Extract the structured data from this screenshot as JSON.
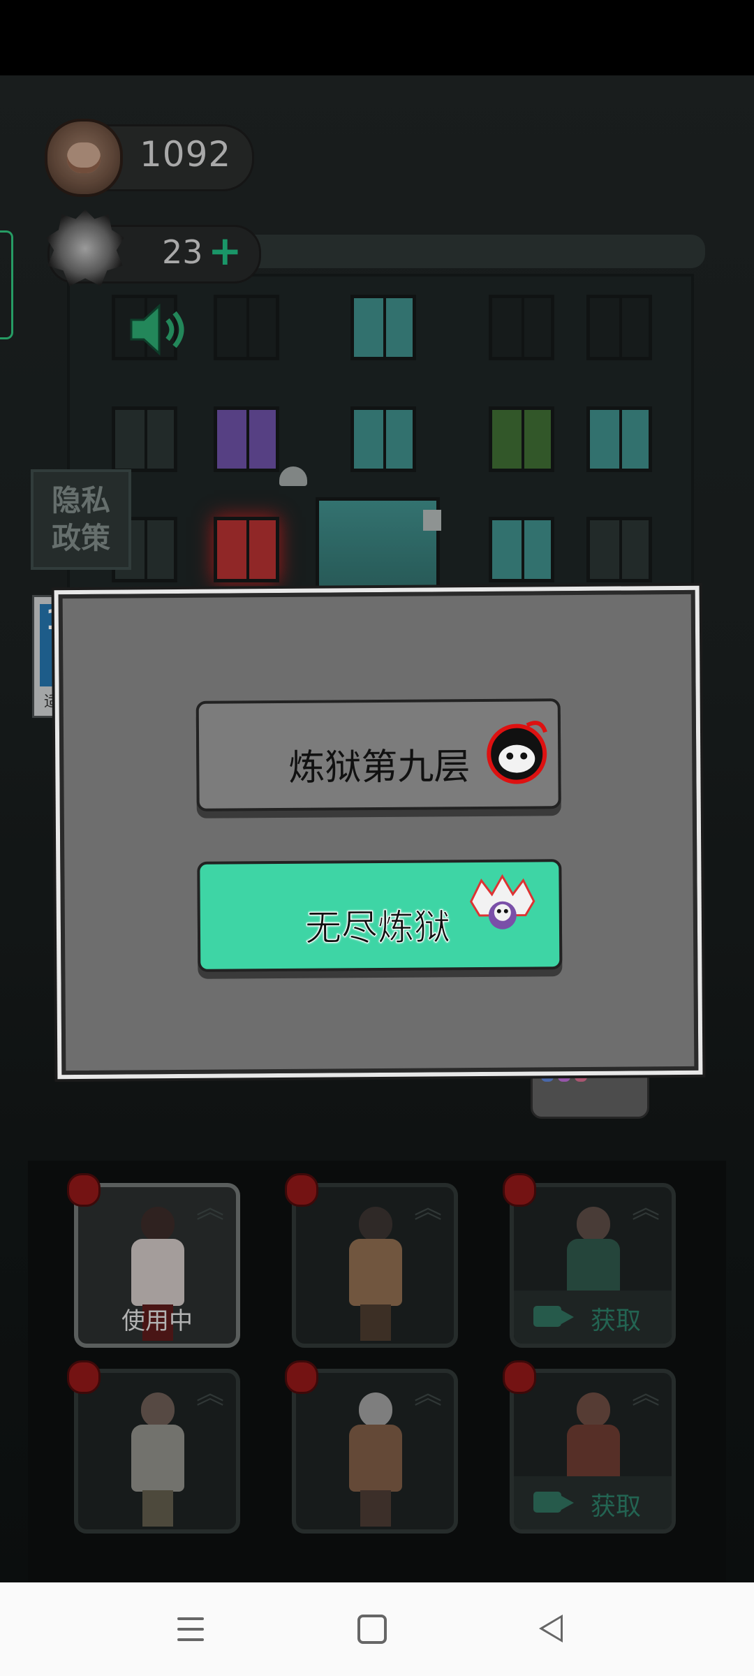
{
  "hud": {
    "coins": "1092",
    "tickets": "23",
    "coin_icon": "coin-icon",
    "ticket_icon": "ticket-icon",
    "plus_icon": "plus-icon"
  },
  "side": {
    "privacy_label": "隐私\n政策",
    "age_number": "1",
    "age_text": "适"
  },
  "dialog": {
    "btn_hell_label": "炼狱第九层",
    "btn_endless_label": "无尽炼狱"
  },
  "characters": [
    {
      "status": "使用中",
      "active": true
    },
    {
      "status": ""
    },
    {
      "status": "获取",
      "locked": true
    },
    {
      "status": ""
    },
    {
      "status": ""
    },
    {
      "status": "获取",
      "locked": true
    }
  ],
  "colors": {
    "accent_green": "#3ed5a5",
    "badge_red": "#8e1818"
  },
  "nav": {
    "menu_icon": "menu-icon",
    "home_icon": "home-icon",
    "back_icon": "back-icon"
  }
}
